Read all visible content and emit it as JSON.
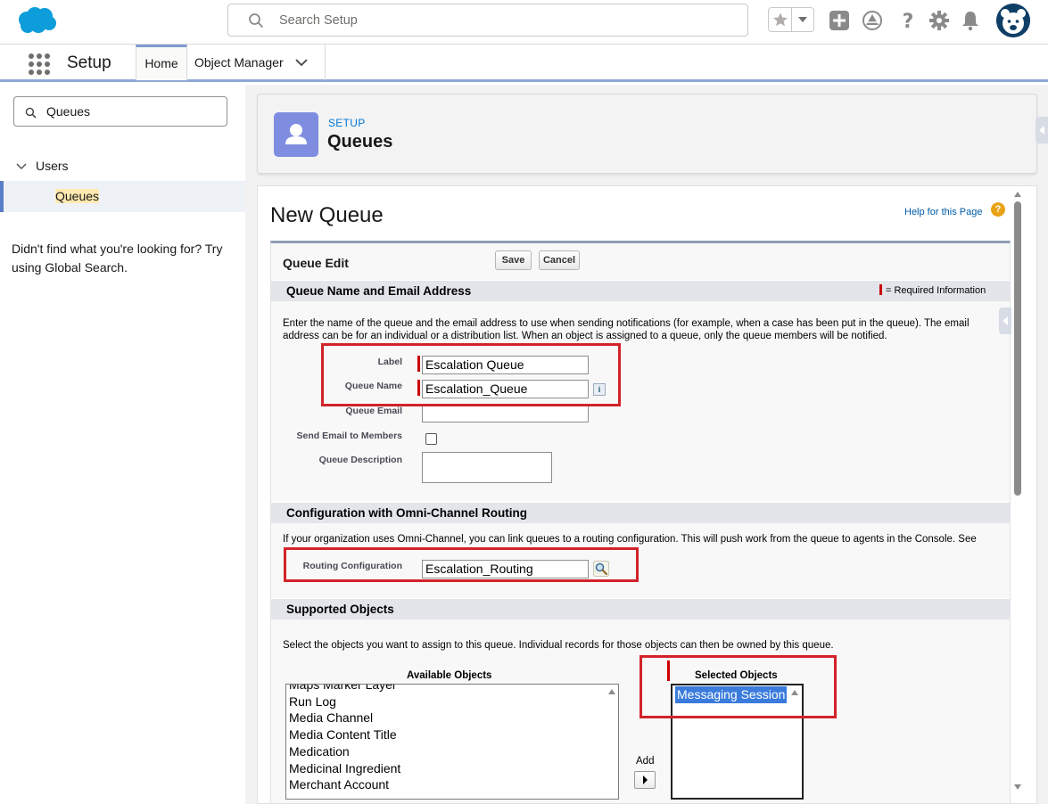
{
  "header": {
    "search_placeholder": "Search Setup"
  },
  "nav": {
    "app_name": "Setup",
    "tab_home": "Home",
    "tab_object_manager": "Object Manager"
  },
  "sidebar": {
    "quick_find_value": "Queues",
    "tree_parent": "Users",
    "tree_child": "Queues",
    "not_found_text": "Didn't find what you're looking for? Try using Global Search."
  },
  "page_header": {
    "eyebrow": "SETUP",
    "title": "Queues"
  },
  "page": {
    "title": "New Queue",
    "help_link": "Help for this Page",
    "help_icon_glyph": "?"
  },
  "form": {
    "heading": "Queue Edit",
    "save_label": "Save",
    "cancel_label": "Cancel",
    "section_name_email": "Queue Name and Email Address",
    "required_info": "= Required Information",
    "intro_text": "Enter the name of the queue and the email address to use when sending notifications (for example, when a case has been put in the queue). The email address can be for an individual or a distribution list. When an object is assigned to a queue, only the queue members will be notified.",
    "label_label": "Label",
    "label_value": "Escalation Queue",
    "queue_name_label": "Queue Name",
    "queue_name_value": "Escalation_Queue",
    "info_glyph": "i",
    "queue_email_label": "Queue Email",
    "send_email_label": "Send Email to Members",
    "description_label": "Queue Description",
    "section_omni": "Configuration with Omni-Channel Routing",
    "omni_text": "If your organization uses Omni-Channel, you can link queues to a routing configuration. This will push work from the queue to agents in the Console. See our help for more information about Routing Configurations.",
    "routing_label": "Routing Configuration",
    "routing_value": "Escalation_Routing",
    "section_supported": "Supported Objects",
    "supported_text": "Select the objects you want to assign to this queue. Individual records for those objects can then be owned by this queue.",
    "available_heading": "Available Objects",
    "available_objects": [
      "Maps Marker Layer",
      "Run Log",
      "Media Channel",
      "Media Content Title",
      "Medication",
      "Medicinal Ingredient",
      "Merchant Account"
    ],
    "add_label": "Add",
    "selected_heading": "Selected Objects",
    "selected_objects": [
      "Messaging Session"
    ]
  },
  "colors": {
    "brand_blue": "#0176d3",
    "highlight_red": "#d2232a",
    "selection_blue": "#3a7bdc",
    "setup_icon": "#7f8de1"
  }
}
